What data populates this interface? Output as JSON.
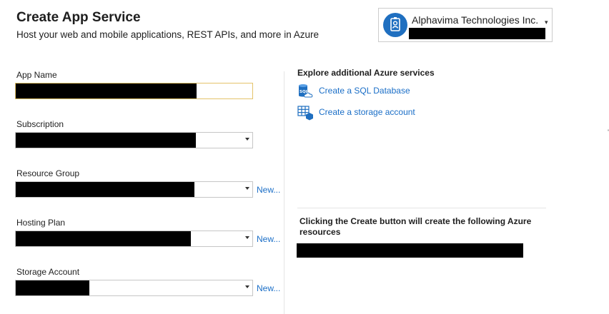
{
  "header": {
    "title": "Create App Service",
    "subtitle": "Host your web and mobile applications, REST APIs, and more in Azure"
  },
  "account": {
    "organization": "Alphavima Technologies Inc."
  },
  "form": {
    "app_name_label": "App Name",
    "subscription_label": "Subscription",
    "resource_group_label": "Resource Group",
    "hosting_plan_label": "Hosting Plan",
    "storage_account_label": "Storage Account",
    "new_link": "New..."
  },
  "explore": {
    "title": "Explore additional Azure services",
    "services": [
      {
        "label": "Create a SQL Database",
        "icon": "sql-database-icon"
      },
      {
        "label": "Create a storage account",
        "icon": "storage-account-icon"
      }
    ]
  },
  "summary": {
    "note": "Clicking the Create button will create the following Azure resources"
  },
  "colors": {
    "link": "#1a6ec7",
    "avatar": "#1f6fc0",
    "focus_border": "#e4c36a"
  }
}
